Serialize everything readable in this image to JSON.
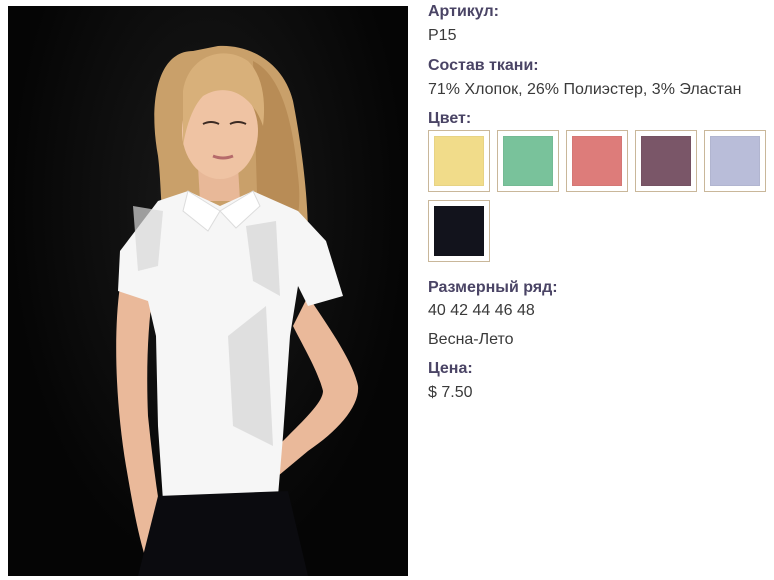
{
  "product": {
    "article_label": "Артикул:",
    "article_value": "P15",
    "composition_label": "Состав ткани:",
    "composition_value": "71% Хлопок, 26% Полиэстер, 3% Эластан",
    "color_label": "Цвет:",
    "colors": [
      {
        "name": "yellow",
        "hex": "#f1dc8a"
      },
      {
        "name": "mint",
        "hex": "#79c29b"
      },
      {
        "name": "coral",
        "hex": "#dd7c7a"
      },
      {
        "name": "plum",
        "hex": "#7a5668"
      },
      {
        "name": "lavender",
        "hex": "#b9bdd9"
      },
      {
        "name": "black",
        "hex": "#12131c"
      }
    ],
    "size_label": "Размерный ряд:",
    "size_value": "40 42 44 46 48",
    "season_value": "Весна-Лето",
    "price_label": "Цена:",
    "price_value": "$ 7.50"
  }
}
